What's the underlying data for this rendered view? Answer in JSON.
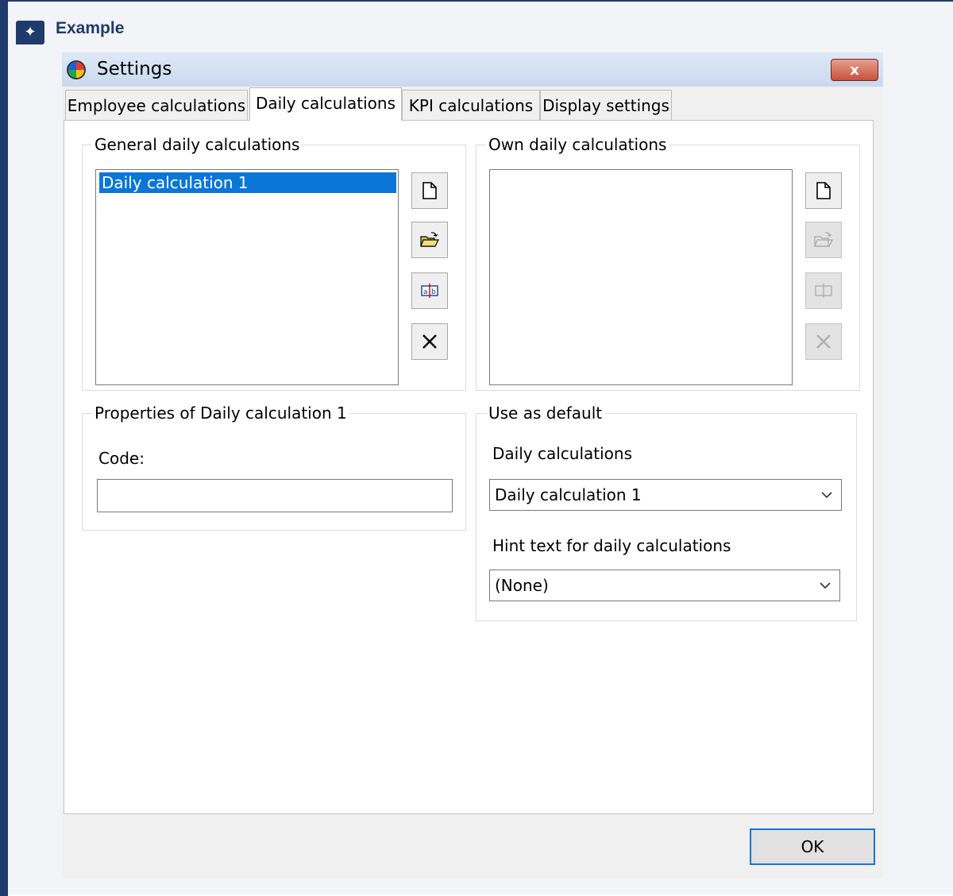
{
  "callout": {
    "title": "Example",
    "badge_icon": "sparkle-icon"
  },
  "window": {
    "title": "Settings",
    "close_label": "x",
    "icon": "color-wheel-icon"
  },
  "tabs": [
    {
      "label": "Employee calculations",
      "active": false
    },
    {
      "label": "Daily calculations",
      "active": true
    },
    {
      "label": "KPI calculations",
      "active": false
    },
    {
      "label": "Display settings",
      "active": false
    }
  ],
  "general": {
    "legend": "General daily calculations",
    "items": [
      {
        "label": "Daily calculation 1",
        "selected": true
      }
    ],
    "buttons": [
      {
        "icon": "new-document-icon",
        "enabled": true
      },
      {
        "icon": "open-folder-icon",
        "enabled": true
      },
      {
        "icon": "rename-icon",
        "enabled": true
      },
      {
        "icon": "delete-icon",
        "enabled": true
      }
    ]
  },
  "own": {
    "legend": "Own daily calculations",
    "items": [],
    "buttons": [
      {
        "icon": "new-document-icon",
        "enabled": true
      },
      {
        "icon": "open-folder-icon",
        "enabled": false
      },
      {
        "icon": "rename-icon",
        "enabled": false
      },
      {
        "icon": "delete-icon",
        "enabled": false
      }
    ]
  },
  "properties": {
    "legend": "Properties of Daily calculation 1",
    "code_label": "Code:",
    "code_value": ""
  },
  "defaults": {
    "legend": "Use as default",
    "daily_label": "Daily calculations",
    "daily_value": "Daily calculation 1",
    "hint_label": "Hint text for daily calculations",
    "hint_value": "(None)"
  },
  "footer": {
    "ok_label": "OK"
  },
  "colors": {
    "accent": "#1f3b6b",
    "selection": "#0a76d8",
    "ok_border": "#1a73d9"
  }
}
